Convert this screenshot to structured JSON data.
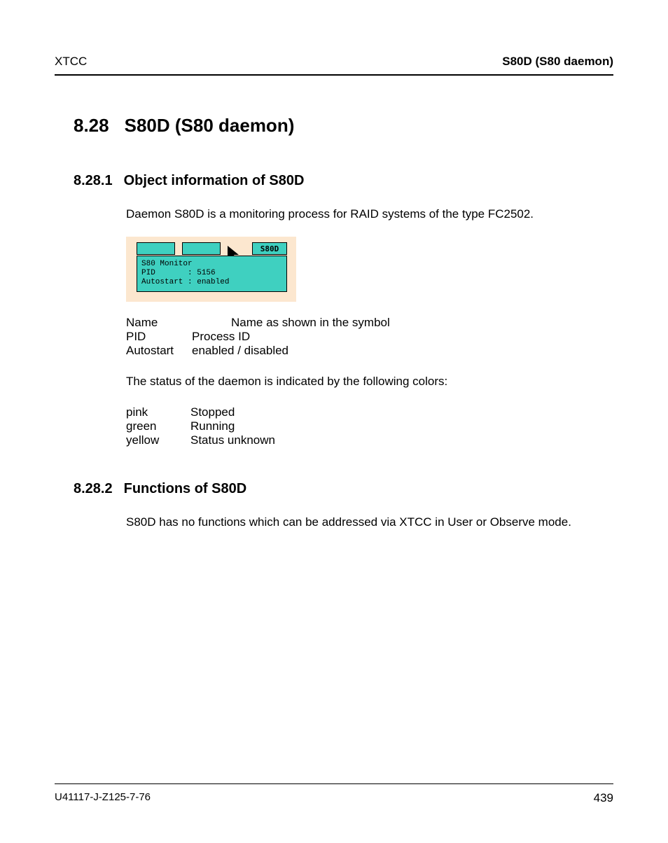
{
  "header": {
    "left": "XTCC",
    "right": "S80D (S80 daemon)"
  },
  "section": {
    "number": "8.28",
    "title": "S80D (S80 daemon)"
  },
  "sub1": {
    "number": "8.28.1",
    "title": "Object information of S80D",
    "intro": "Daemon S80D is a monitoring process for RAID systems of the type FC2502.",
    "figure": {
      "tab3_label": "S80D",
      "box_line1": "S80 Monitor",
      "box_line2": "PID       : 5156",
      "box_line3": "Autostart : enabled"
    },
    "defs": [
      {
        "k": "Name",
        "v": "Name as shown in the symbol",
        "indent": true
      },
      {
        "k": "PID",
        "v": "Process ID",
        "indent": false
      },
      {
        "k": "Autostart",
        "v": "enabled / disabled",
        "indent": false
      }
    ],
    "status_intro": "The status of the daemon is indicated by the following colors:",
    "statuses": [
      {
        "k": "pink",
        "v": "Stopped"
      },
      {
        "k": "green",
        "v": "Running"
      },
      {
        "k": "yellow",
        "v": "Status unknown"
      }
    ]
  },
  "sub2": {
    "number": "8.28.2",
    "title": "Functions of  S80D",
    "body": "S80D has no functions which can be addressed via XTCC in User or Observe mode."
  },
  "footer": {
    "left": "U41117-J-Z125-7-76",
    "page": "439"
  }
}
